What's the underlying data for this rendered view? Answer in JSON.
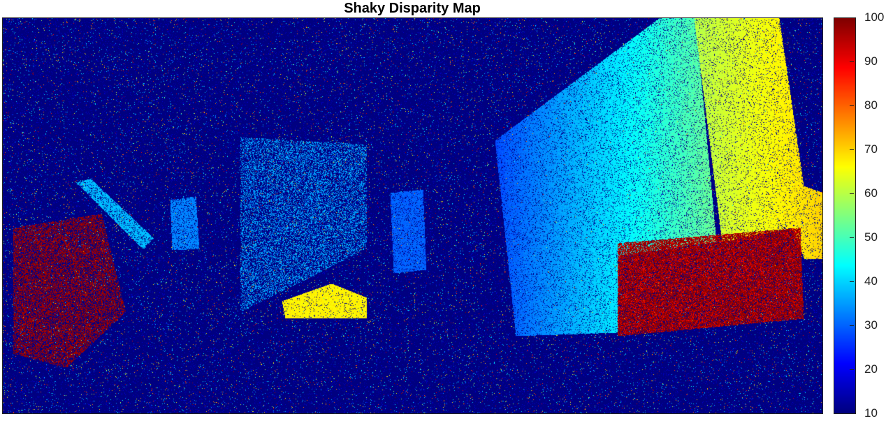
{
  "chart_data": {
    "type": "heatmap",
    "title": "Shaky Disparity Map",
    "colormap": "jet",
    "colorbar": {
      "range": [
        10,
        100
      ],
      "ticks": [
        10,
        20,
        30,
        40,
        50,
        60,
        70,
        80,
        90,
        100
      ],
      "tick_labels": [
        "10",
        "20",
        "30",
        "40",
        "50",
        "60",
        "70",
        "80",
        "90",
        "100"
      ],
      "placement": "right"
    },
    "background_value": 10,
    "regions": [
      {
        "name": "right-wall-near",
        "approx_value": 68
      },
      {
        "name": "right-wall-far",
        "approx_value": 52
      },
      {
        "name": "center-wall",
        "approx_value": 36
      },
      {
        "name": "yellow-object",
        "approx_value": 67
      },
      {
        "name": "right-box",
        "approx_value": 100
      },
      {
        "name": "left-dark-red-patch",
        "approx_value": 100
      },
      {
        "name": "left-doorway",
        "approx_value": 38
      },
      {
        "name": "center-door",
        "approx_value": 30
      },
      {
        "name": "left-window",
        "approx_value": 33
      }
    ],
    "grid": false,
    "legend": "colorbar-right"
  }
}
